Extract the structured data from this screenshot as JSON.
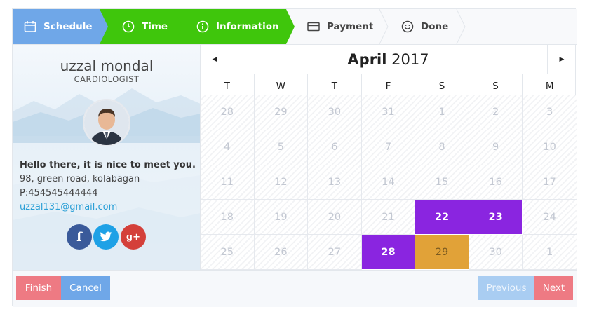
{
  "steps": [
    {
      "label": "Schedule",
      "icon": "calendar-icon",
      "state": "done"
    },
    {
      "label": "Time",
      "icon": "clock-icon",
      "state": "done"
    },
    {
      "label": "Information",
      "icon": "info-icon",
      "state": "active"
    },
    {
      "label": "Payment",
      "icon": "credit-card-icon",
      "state": "pending"
    },
    {
      "label": "Done",
      "icon": "smiley-icon",
      "state": "pending"
    }
  ],
  "profile": {
    "name": "uzzal mondal",
    "role": "CARDIOLOGIST",
    "greeting": "Hello there, it is nice to meet you.",
    "address": "98, green road, kolabagan",
    "phone": "P:454545444444",
    "email": "uzzal131@gmail.com",
    "social": [
      {
        "label": "f",
        "icon": "facebook-icon",
        "color": "#3a5a9a"
      },
      {
        "label": "",
        "icon": "twitter-icon",
        "color": "#1ea1e6"
      },
      {
        "label": "g+",
        "icon": "google-plus-icon",
        "color": "#d4403a"
      }
    ]
  },
  "calendar": {
    "month": "April",
    "year": "2017",
    "weekdays": [
      "T",
      "W",
      "T",
      "F",
      "S",
      "S",
      "M"
    ],
    "weeks": [
      [
        {
          "d": "28"
        },
        {
          "d": "29"
        },
        {
          "d": "30"
        },
        {
          "d": "31"
        },
        {
          "d": "1"
        },
        {
          "d": "2"
        },
        {
          "d": "3"
        }
      ],
      [
        {
          "d": "4"
        },
        {
          "d": "5"
        },
        {
          "d": "6"
        },
        {
          "d": "7"
        },
        {
          "d": "8"
        },
        {
          "d": "9"
        },
        {
          "d": "10"
        }
      ],
      [
        {
          "d": "11"
        },
        {
          "d": "12"
        },
        {
          "d": "13"
        },
        {
          "d": "14"
        },
        {
          "d": "15"
        },
        {
          "d": "16"
        },
        {
          "d": "17"
        }
      ],
      [
        {
          "d": "18"
        },
        {
          "d": "19"
        },
        {
          "d": "20"
        },
        {
          "d": "21"
        },
        {
          "d": "22",
          "state": "available"
        },
        {
          "d": "23",
          "state": "available"
        },
        {
          "d": "24"
        }
      ],
      [
        {
          "d": "25"
        },
        {
          "d": "26"
        },
        {
          "d": "27"
        },
        {
          "d": "28",
          "state": "available"
        },
        {
          "d": "29",
          "state": "selected"
        },
        {
          "d": "30"
        },
        {
          "d": "1"
        }
      ]
    ]
  },
  "footer": {
    "finish_label": "Finish",
    "cancel_label": "Cancel",
    "previous_label": "Previous",
    "next_label": "Next"
  },
  "colors": {
    "schedule_step": "#6fa7e8",
    "active_step": "#3fc60c",
    "available_day": "#8a25e0",
    "selected_day": "#e1a238",
    "finish_button": "#ee7a83",
    "cancel_button": "#6fa7e8"
  }
}
